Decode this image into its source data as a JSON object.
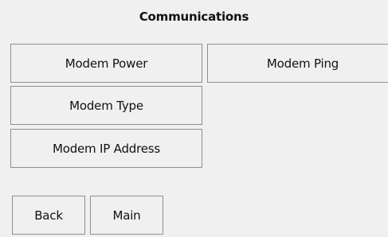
{
  "screen": {
    "title": "Communications"
  },
  "buttons": {
    "modem_power": "Modem Power",
    "modem_ping": "Modem Ping",
    "modem_type": "Modem Type",
    "modem_ip_address": "Modem IP Address",
    "back": "Back",
    "main": "Main"
  },
  "colors": {
    "background": "#f0f0f0",
    "button_border": "#8f8f8f",
    "text": "#111111"
  }
}
